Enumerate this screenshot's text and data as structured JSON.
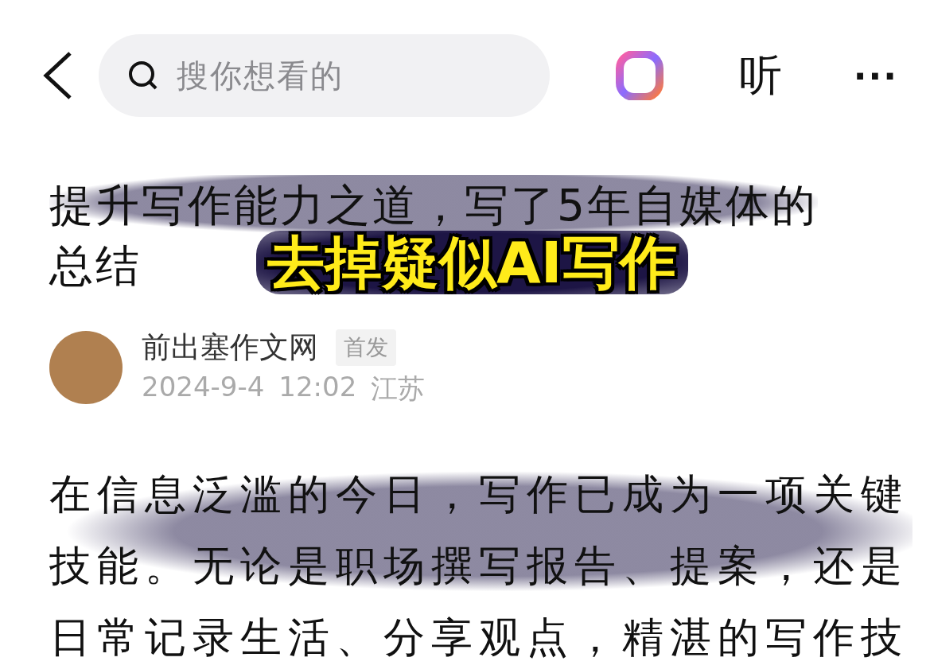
{
  "header": {
    "search_placeholder": "搜你想看的",
    "listen_label": "听",
    "more_label": "···"
  },
  "article": {
    "title_lines": [
      "提升写作能力之道，写了5年自媒体的",
      "总结"
    ],
    "author": "前出塞作文网",
    "badge": "首发",
    "date": "2024-9-4",
    "time": "12:02",
    "location": "江苏",
    "body": "在信息泛滥的今日，写作已成为一项关键技能。无论是职场撰写报告、提案，还是日常记录生活、分享观点，精湛的写作技"
  },
  "caption": "去掉疑似AI写作"
}
